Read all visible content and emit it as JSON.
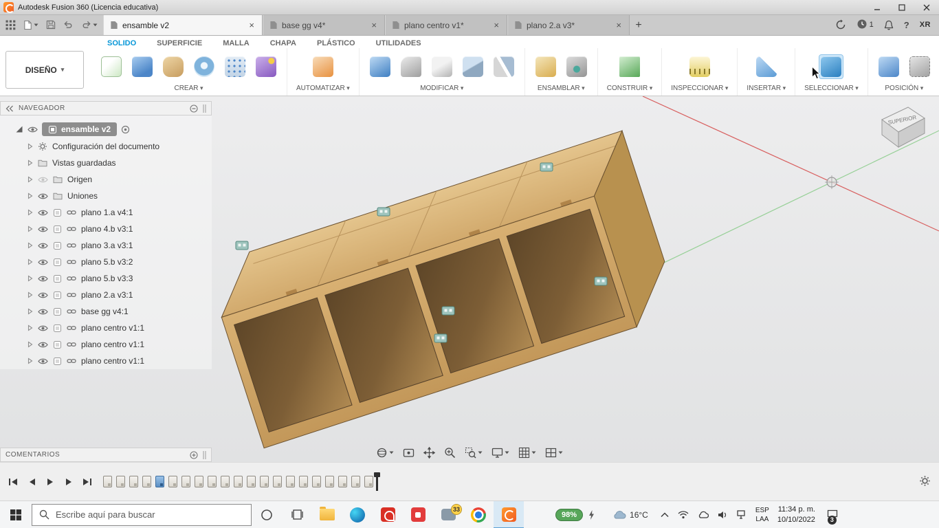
{
  "accent": {
    "fusion_orange": "#f05a22",
    "active_blue": "#0696d7",
    "select_highlight": "#cfe8fa"
  },
  "title_bar": {
    "title": "Autodesk Fusion 360 (Licencia educativa)"
  },
  "document_tabs": {
    "tabs": [
      {
        "label": "ensamble v2",
        "active": true
      },
      {
        "label": "base gg v4*",
        "active": false
      },
      {
        "label": "plano centro v1*",
        "active": false
      },
      {
        "label": "plano 2.a v3*",
        "active": false
      }
    ],
    "add_tab": "+",
    "job_status_count": "1",
    "avatar_initials": "XR",
    "help_glyph": "?"
  },
  "ribbon": {
    "workspace": "DISEÑO",
    "tabs": [
      {
        "label": "SOLIDO",
        "active": true
      },
      {
        "label": "SUPERFICIE",
        "active": false
      },
      {
        "label": "MALLA",
        "active": false
      },
      {
        "label": "CHAPA",
        "active": false
      },
      {
        "label": "PLÁSTICO",
        "active": false
      },
      {
        "label": "UTILIDADES",
        "active": false
      }
    ],
    "groups": [
      {
        "label": "CREAR",
        "icons": [
          {
            "name": "create-sketch-icon",
            "cls": "ic-sketch"
          },
          {
            "name": "box-primitive-icon",
            "cls": "ic-box"
          },
          {
            "name": "cylinder-primitive-icon",
            "cls": "ic-cyl"
          },
          {
            "name": "torus-primitive-icon",
            "cls": "ic-torus"
          },
          {
            "name": "pattern-icon",
            "cls": "ic-pattern"
          },
          {
            "name": "create-form-icon",
            "cls": "ic-form"
          }
        ]
      },
      {
        "label": "AUTOMATIZAR",
        "icons": [
          {
            "name": "automate-icon",
            "cls": "ic-automate"
          }
        ]
      },
      {
        "label": "MODIFICAR",
        "icons": [
          {
            "name": "press-pull-icon",
            "cls": "ic-presspull"
          },
          {
            "name": "fillet-icon",
            "cls": "ic-fillet"
          },
          {
            "name": "shell-icon",
            "cls": "ic-shell"
          },
          {
            "name": "combine-icon",
            "cls": "ic-combine"
          },
          {
            "name": "split-body-icon",
            "cls": "ic-split"
          }
        ]
      },
      {
        "label": "ENSAMBLAR",
        "icons": [
          {
            "name": "new-component-icon",
            "cls": "ic-newcomp"
          },
          {
            "name": "joint-icon",
            "cls": "ic-joint"
          }
        ]
      },
      {
        "label": "CONSTRUIR",
        "icons": [
          {
            "name": "construction-plane-icon",
            "cls": "ic-planes"
          }
        ]
      },
      {
        "label": "INSPECCIONAR",
        "icons": [
          {
            "name": "measure-icon",
            "cls": "ic-measure"
          }
        ]
      },
      {
        "label": "INSERTAR",
        "icons": [
          {
            "name": "insert-icon",
            "cls": "ic-insert"
          }
        ]
      },
      {
        "label": "SELECCIONAR",
        "icons": [
          {
            "name": "select-tool-icon",
            "cls": "ic-select",
            "active": true
          }
        ]
      },
      {
        "label": "POSICIÓN",
        "icons": [
          {
            "name": "capture-position-icon",
            "cls": "ic-capture"
          },
          {
            "name": "revert-position-icon",
            "cls": "ic-revert"
          }
        ]
      }
    ]
  },
  "navigator": {
    "header": "NAVEGADOR",
    "root": {
      "label": "ensamble v2"
    },
    "items": [
      {
        "label": "Configuración del documento",
        "type": "settings"
      },
      {
        "label": "Vistas guardadas",
        "type": "folder"
      },
      {
        "label": "Origen",
        "type": "folder-hidden"
      },
      {
        "label": "Uniones",
        "type": "folder-visible"
      },
      {
        "label": "plano 1.a v4:1",
        "type": "component"
      },
      {
        "label": "plano 4.b v3:1",
        "type": "component"
      },
      {
        "label": "plano 3.a v3:1",
        "type": "component"
      },
      {
        "label": "plano 5.b v3:2",
        "type": "component"
      },
      {
        "label": "plano 5.b v3:3",
        "type": "component"
      },
      {
        "label": "plano 2.a v3:1",
        "type": "component"
      },
      {
        "label": "base gg v4:1",
        "type": "component"
      },
      {
        "label": "plano centro v1:1",
        "type": "component"
      },
      {
        "label": "plano centro v1:1",
        "type": "component"
      },
      {
        "label": "plano centro v1:1",
        "type": "component"
      }
    ]
  },
  "comments_panel": {
    "header": "COMENTARIOS"
  },
  "viewcube": {
    "top_face": "SUPERIOR"
  },
  "view_toolbar": [
    {
      "name": "orbit-icon",
      "dropdown": true
    },
    {
      "name": "look-at-icon",
      "dropdown": false
    },
    {
      "name": "pan-icon",
      "dropdown": false
    },
    {
      "name": "zoom-icon",
      "dropdown": false
    },
    {
      "name": "zoom-window-icon",
      "dropdown": true
    },
    {
      "name": "display-settings-icon",
      "dropdown": true
    },
    {
      "name": "grid-settings-icon",
      "dropdown": true
    },
    {
      "name": "viewports-icon",
      "dropdown": true
    }
  ],
  "timeline": {
    "markers": [
      "op",
      "op",
      "op",
      "op",
      "sketch-blue",
      "op",
      "op",
      "op",
      "op",
      "op",
      "op",
      "op",
      "op",
      "op",
      "op",
      "op",
      "op",
      "op",
      "op",
      "op",
      "op"
    ]
  },
  "taskbar": {
    "search_placeholder": "Escribe aquí para buscar",
    "battery": "98%",
    "weather": "16°C",
    "input_lang": "ESP",
    "input_layout": "LAA",
    "time": "11:34 p. m.",
    "date": "10/10/2022",
    "notification_count": "3",
    "messages_badge": "33"
  }
}
